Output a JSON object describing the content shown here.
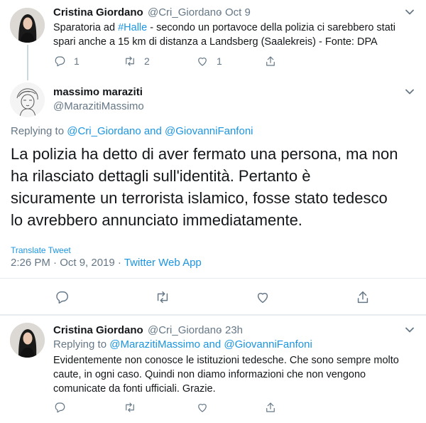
{
  "tweet1": {
    "author_name": "Cristina Giordano",
    "handle": "@Cri_Giordano",
    "separator": "·",
    "date": "Oct 9",
    "text_prefix": "Sparatoria ad ",
    "hashtag": "#Halle",
    "text_line1_rest": " - secondo un portavoce della polizia ci sarebbero stati",
    "text_line2": "spari anche a 15 km di distanza a Landsberg (Saalekreis) - Fonte: DPA",
    "reply_count": "1",
    "retweet_count": "2",
    "like_count": "1"
  },
  "main_tweet": {
    "author_name": "massimo maraziti",
    "handle": "@MarazitiMassimo",
    "replying_prefix": "Replying to",
    "reply_to_1": "@Cri_Giordano",
    "and_word": "and",
    "reply_to_2": "@GiovanniFanfoni",
    "text_lines": [
      "La polizia ha detto di aver fermato una persona, ma non",
      "ha rilasciato dettagli sull'identità. Pertanto è",
      "sicuramente un terrorista islamico, fosse stato tedesco",
      "lo avrebbero annunciato immediatamente."
    ],
    "translate_label": "Translate Tweet",
    "timestamp": "2:26 PM · Oct 9, 2019",
    "dot": "·",
    "source": "Twitter Web App"
  },
  "tweet3": {
    "author_name": "Cristina Giordano",
    "handle": "@Cri_Giordano",
    "separator": "·",
    "date": "23h",
    "replying_prefix": "Replying to",
    "reply_to_1": "@MarazitiMassimo",
    "and_word": "and",
    "reply_to_2": "@GiovanniFanfoni",
    "text_lines": [
      "Evidentemente non conosce le istituzioni tedesche. Che sono sempre molto",
      "caute, in ogni caso. Quindi non diamo informazioni che non vengono",
      "comunicate da fonti ufficiali. Grazie."
    ]
  },
  "icons": {
    "reply": "reply-icon",
    "retweet": "retweet-icon",
    "like": "heart-icon",
    "share": "share-icon",
    "more": "chevron-down-icon"
  },
  "colors": {
    "link": "#1b95e0",
    "muted": "#657786",
    "text": "#14171a",
    "divider": "#e6ecf0"
  }
}
